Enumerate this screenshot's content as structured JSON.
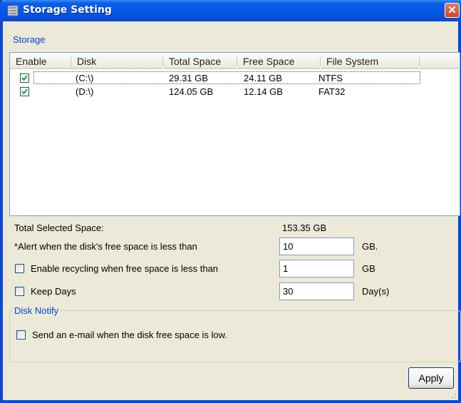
{
  "window": {
    "title": "Storage Setting",
    "close_symbol": "✕"
  },
  "storage": {
    "legend": "Storage",
    "columns": [
      "Enable",
      "Disk",
      "Total Space",
      "Free Space",
      "File System"
    ],
    "rows": [
      {
        "enabled": true,
        "disk": "(C:\\)",
        "total": "29.31 GB",
        "free": "24.11 GB",
        "fs": "NTFS"
      },
      {
        "enabled": true,
        "disk": "(D:\\)",
        "total": "124.05 GB",
        "free": "12.14 GB",
        "fs": "FAT32"
      }
    ]
  },
  "summary": {
    "total_label": "Total Selected Space:",
    "total_value": "153.35 GB"
  },
  "alert": {
    "label": "*Alert when the disk's free space is less than",
    "value": "10",
    "unit": "GB."
  },
  "recycling": {
    "checked": false,
    "label": "Enable recycling when free space is less than",
    "value": "1",
    "unit": "GB"
  },
  "keep_days": {
    "checked": false,
    "label": "Keep Days",
    "value": "30",
    "unit": "Day(s)"
  },
  "disk_notify": {
    "legend": "Disk Notify",
    "checked": false,
    "label": "Send an e-mail when the disk free space is low."
  },
  "buttons": {
    "apply": "Apply"
  }
}
